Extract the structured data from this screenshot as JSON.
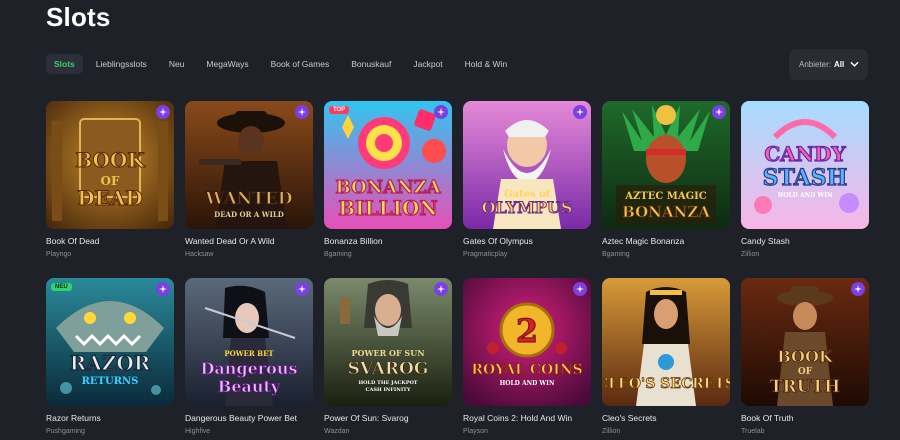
{
  "page": {
    "title": "Slots"
  },
  "tabs": [
    {
      "label": "Slots",
      "active": true
    },
    {
      "label": "Lieblingsslots"
    },
    {
      "label": "Neu"
    },
    {
      "label": "MegaWays"
    },
    {
      "label": "Book of Games"
    },
    {
      "label": "Bonuskauf"
    },
    {
      "label": "Jackpot"
    },
    {
      "label": "Hold & Win"
    }
  ],
  "provider_filter": {
    "label": "Anbieter:",
    "value": "All"
  },
  "colors": {
    "accent": "#3ecf6a",
    "badge": "#7b3fe4",
    "background": "#1f2128"
  },
  "games": [
    {
      "name": "Book Of Dead",
      "provider": "Playngo",
      "art": [
        "BOOK",
        "OF",
        "DEAD"
      ],
      "badge": "sparkle-icon"
    },
    {
      "name": "Wanted Dead Or A Wild",
      "provider": "Hacksaw",
      "art": [
        "WANTED",
        "DEAD OR A WILD"
      ],
      "badge": "sparkle-icon"
    },
    {
      "name": "Bonanza Billion",
      "provider": "Bgaming",
      "art": [
        "BONANZA",
        "BILLION"
      ],
      "tag": "TOP",
      "badge": "sparkle-icon"
    },
    {
      "name": "Gates Of Olympus",
      "provider": "Pragmaticplay",
      "art": [
        "Gates of",
        "OLYMPUS"
      ],
      "badge": "sparkle-icon"
    },
    {
      "name": "Aztec Magic Bonanza",
      "provider": "Bgaming",
      "art": [
        "AZTEC MAGIC",
        "BONANZA"
      ],
      "badge": "sparkle-icon"
    },
    {
      "name": "Candy Stash",
      "provider": "Zillion",
      "art": [
        "CANDY",
        "STASH",
        "HOLD AND WIN"
      ]
    },
    {
      "name": "Razor Returns",
      "provider": "Pushgaming",
      "art": [
        "RAZOR",
        "RETURNS"
      ],
      "tag": "NEU",
      "badge": "sparkle-icon"
    },
    {
      "name": "Dangerous Beauty Power Bet",
      "provider": "Highfive",
      "art": [
        "POWER BET",
        "Dangerous",
        "Beauty"
      ],
      "badge": "sparkle-icon"
    },
    {
      "name": "Power Of Sun: Svarog",
      "provider": "Wazdan",
      "art": [
        "POWER OF SUN",
        "SVAROG",
        "HOLD THE JACKPOT",
        "CASH INFINITY"
      ],
      "badge": "sparkle-icon"
    },
    {
      "name": "Royal Coins 2: Hold And Win",
      "provider": "Playson",
      "art": [
        "2",
        "ROYAL COINS",
        "HOLD AND WIN"
      ],
      "badge": "sparkle-icon"
    },
    {
      "name": "Cleo's Secrets",
      "provider": "Zillion",
      "art": [
        "CLEO'S SECRETS"
      ]
    },
    {
      "name": "Book Of Truth",
      "provider": "Truelab",
      "art": [
        "BOOK",
        "OF",
        "TRUTH"
      ],
      "badge": "sparkle-icon"
    }
  ]
}
